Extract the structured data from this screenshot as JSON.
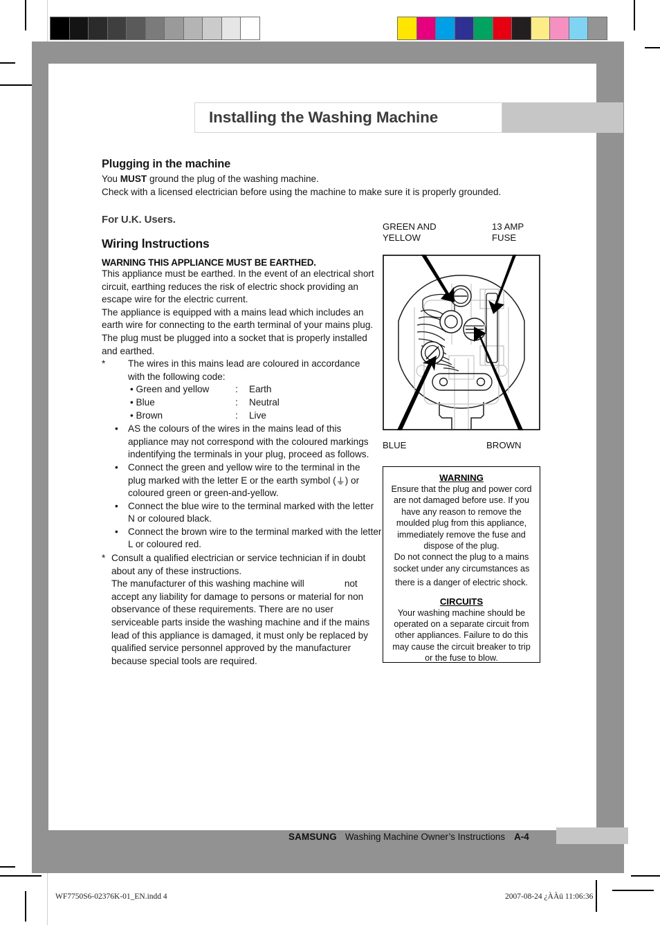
{
  "calibration": {
    "grayscale_label": "grayscale-step-wedge",
    "grayscale": [
      "#000000",
      "#141414",
      "#2b2b2b",
      "#3f3f3f",
      "#5a5a5a",
      "#7b7b7b",
      "#9a9a9a",
      "#b4b4b4",
      "#cbcbcb",
      "#e6e6e6",
      "#ffffff"
    ],
    "color_label": "color-control-patches",
    "colors": [
      "#ffe600",
      "#e6007e",
      "#00a0e9",
      "#2e3192",
      "#00a360",
      "#e60012",
      "#231f20",
      "#fced86",
      "#f590c1",
      "#7fd4f4",
      "#949494"
    ]
  },
  "header": {
    "chapter_title": "Installing the Washing Machine"
  },
  "section": {
    "title": "Plugging in the machine",
    "lead_1_pre": "You ",
    "lead_1_bold": "MUST",
    "lead_1_post": " ground the plug of the washing machine.",
    "lead_2": "Check with a licensed electrician before using the machine to make sure it is properly grounded.",
    "uk_heading": "For U.K. Users.",
    "wiring_heading": "Wiring lnstructions",
    "warning_caps": "WARNING THIS APPLIANCE MUST BE EARTHED.",
    "para_1": "This appliance must be earthed.  In the event of an electrical short circuit, earthing reduces the risk of electric shock providing an escape wire for the electric current.",
    "para_2": "The appliance is equipped with a mains lead which includes an earth wire for connecting to the earth terminal of your mains plug.",
    "para_3": "The plug must be plugged into a socket that is properly installed and earthed.",
    "star_1_marker": "*",
    "star_1_text": "The wires in this mains lead are coloured in accordance with the following code:",
    "wire_code": [
      {
        "bullet": "•",
        "name": "Green and yellow",
        "colon": ":",
        "function": "Earth"
      },
      {
        "bullet": "•",
        "name": "Blue",
        "colon": ":",
        "function": "Neutral"
      },
      {
        "bullet": "•",
        "name": "Brown",
        "colon": ":",
        "function": "Live"
      }
    ],
    "bullets": [
      {
        "marker": "•",
        "text": "AS the colours of the wires in the mains lead of this appliance may not correspond with the coloured markings indentifying the terminals in your plug, proceed as follows."
      },
      {
        "marker": "•",
        "text_pre": "Connect the green and yellow wire to the terminal in the plug marked with the letter E or the earth symbol (",
        "symbol": "⏚",
        "text_post": ") or coloured green or green-and-yellow."
      },
      {
        "marker": "•",
        "text": "Connect the blue wire to the terminal marked with the letter N or coloured black."
      },
      {
        "marker": "•",
        "text": "Connect the brown wire to the terminal marked   with the letter L or coloured red."
      }
    ],
    "star_2_marker": "*",
    "star_2_text": "Consult a qualified electrician or service technician if in doubt about any of these instructions.",
    "closing_pre": "The manufacturer of this washing machine will",
    "closing_not": "not",
    "closing_post": "accept any liability for damage to persons or material for non observance of these requirements.  There are no user serviceable parts inside the washing machine and if the mains lead of this appliance is damaged, it must only be replaced by qualified service personnel approved by the manufacturer because special tools are required."
  },
  "figure": {
    "name": "uk-13-amp-plug-wiring-diagram",
    "labels": {
      "green_yellow": "GREEN AND\nYELLOW",
      "green_yellow_line1": "GREEN AND",
      "green_yellow_line2": "YELLOW",
      "fuse_line1": "13 AMP",
      "fuse_line2": "FUSE",
      "blue": "BLUE",
      "brown": "BROWN"
    }
  },
  "warning_box": {
    "warning_heading": "WARNING",
    "warning_body_1": "Ensure that the plug and power cord are not damaged before use. If you have any reason to remove the moulded plug from this appliance, immediately remove the fuse and dispose of the plug.",
    "warning_body_2": "Do not connect the plug to a mains socket under any circumstances as",
    "warning_body_3": "there is a danger of electric shock.",
    "circuits_heading": "CIRCUITS",
    "circuits_body": "Your washing machine should be operated on a separate circuit from other appliances.  Failure to do this may cause the circuit breaker to trip or the fuse to blow."
  },
  "footer": {
    "brand": "SAMSUNG",
    "doc_title": "Washing Machine Owner’s Instructions",
    "page_number": "A-4"
  },
  "print_slug": {
    "filename": "WF7750S6-02376K-01_EN.indd   4",
    "timestamp": "2007-08-24   ¿ÀÀü 11:06:36"
  }
}
